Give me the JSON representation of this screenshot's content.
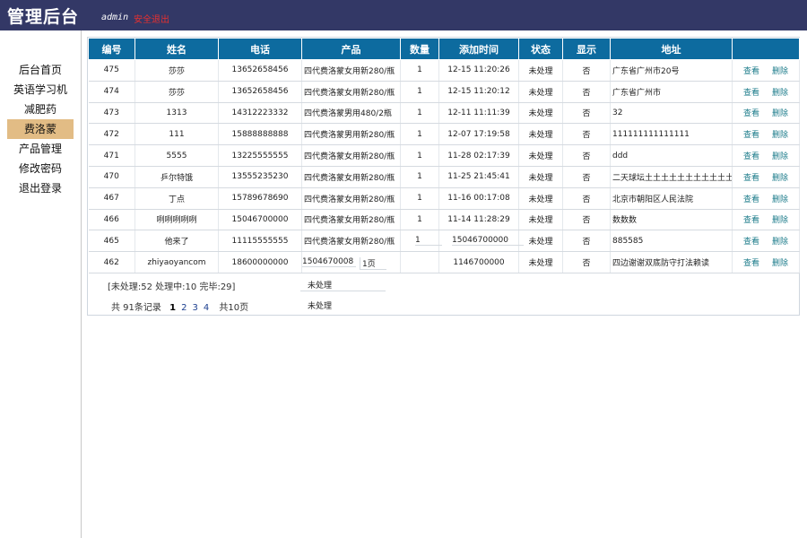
{
  "header": {
    "title": "管理后台",
    "admin": "admin",
    "logout": "安全退出"
  },
  "sidebar": {
    "items": [
      {
        "label": "后台首页",
        "active": false
      },
      {
        "label": "英语学习机",
        "active": false
      },
      {
        "label": "减肥药",
        "active": false
      },
      {
        "label": "费洛蒙",
        "active": true
      },
      {
        "label": "产品管理",
        "active": false
      },
      {
        "label": "修改密码",
        "active": false
      },
      {
        "label": "退出登录",
        "active": false
      }
    ]
  },
  "table": {
    "columns": [
      "编号",
      "姓名",
      "电话",
      "产品",
      "数量",
      "添加时间",
      "状态",
      "显示",
      "地址",
      ""
    ],
    "view_label": "查看",
    "delete_label": "删除",
    "rows": [
      {
        "id": "475",
        "name": "莎莎",
        "phone": "13652658456",
        "product": "四代费洛蒙女用新280/瓶",
        "qty": "1",
        "time": "12-15 11:20:26",
        "status": "未处理",
        "show": "否",
        "address": "广东省广州市20号"
      },
      {
        "id": "474",
        "name": "莎莎",
        "phone": "13652658456",
        "product": "四代费洛蒙女用新280/瓶",
        "qty": "1",
        "time": "12-15 11:20:12",
        "status": "未处理",
        "show": "否",
        "address": "广东省广州市"
      },
      {
        "id": "473",
        "name": "1313",
        "phone": "14312223332",
        "product": "四代费洛蒙男用480/2瓶",
        "qty": "1",
        "time": "12-11 11:11:39",
        "status": "未处理",
        "show": "否",
        "address": "32"
      },
      {
        "id": "472",
        "name": "111",
        "phone": "15888888888",
        "product": "四代费洛蒙男用新280/瓶",
        "qty": "1",
        "time": "12-07 17:19:58",
        "status": "未处理",
        "show": "否",
        "address": "111111111111111"
      },
      {
        "id": "471",
        "name": "5555",
        "phone": "13225555555",
        "product": "四代费洛蒙女用新280/瓶",
        "qty": "1",
        "time": "11-28 02:17:39",
        "status": "未处理",
        "show": "否",
        "address": "ddd"
      },
      {
        "id": "470",
        "name": "乒尔特饿",
        "phone": "13555235230",
        "product": "四代费洛蒙女用新280/瓶",
        "qty": "1",
        "time": "11-25 21:45:41",
        "status": "未处理",
        "show": "否",
        "address": "二天球坛土土土土土土土土土土土"
      },
      {
        "id": "467",
        "name": "丁点",
        "phone": "15789678690",
        "product": "四代费洛蒙女用新280/瓶",
        "qty": "1",
        "time": "11-16 00:17:08",
        "status": "未处理",
        "show": "否",
        "address": "北京市朝阳区人民法院"
      },
      {
        "id": "466",
        "name": "咧咧咧咧咧",
        "phone": "15046700000",
        "product": "四代费洛蒙女用新280/瓶",
        "qty": "1",
        "time": "11-14 11:28:29",
        "status": "未处理",
        "show": "否",
        "address": "数数数"
      },
      {
        "id": "465",
        "name": "他来了",
        "phone": "11115555555",
        "product": "四代费洛蒙女用新280/瓶",
        "qty": "",
        "time": "",
        "status": "未处理",
        "show": "否",
        "address": "885585"
      },
      {
        "id": "462",
        "name": "zhiyaoyancom",
        "phone": "18600000000",
        "product": "",
        "qty": "",
        "time": "1146700000",
        "status": "未处理",
        "show": "否",
        "address": "四边谢谢双底防守打法赖读"
      }
    ]
  },
  "stray": {
    "qty_465": "1",
    "phone_465": "15046700000",
    "phone_462": "1504670008",
    "page_462": "1页",
    "status_a": "未处理",
    "status_b": "未处理"
  },
  "summary": {
    "text": "[未处理:52  处理中:10  完毕:29]"
  },
  "pagination": {
    "prefix": "共 91条记录",
    "pages": [
      "1",
      "2",
      "3",
      "4"
    ],
    "current": "1",
    "total": "共10页"
  }
}
